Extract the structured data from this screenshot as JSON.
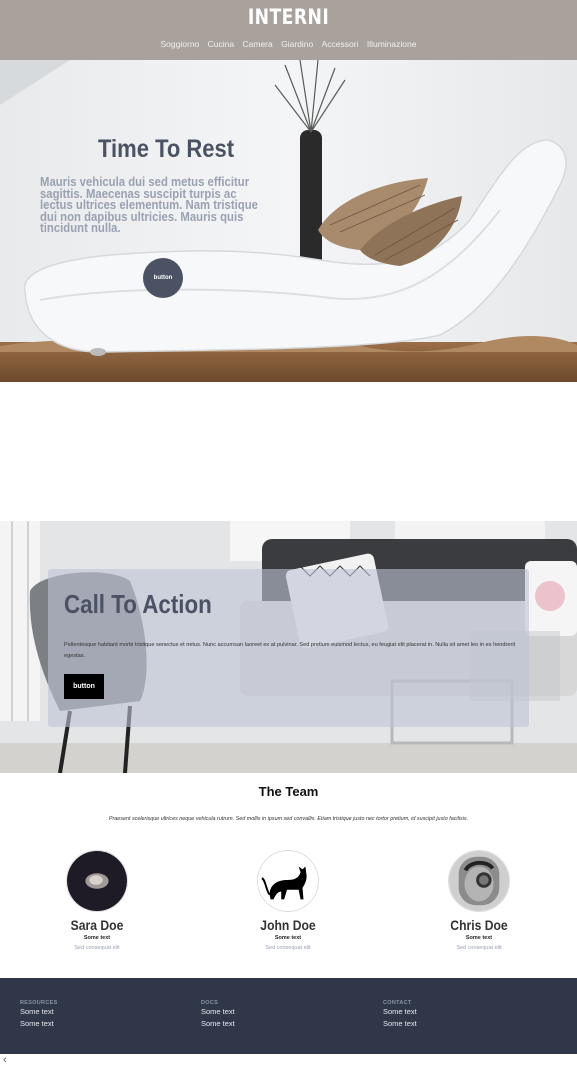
{
  "header": {
    "brand": "INTERNI",
    "nav": [
      "Soggiorno",
      "Cucina",
      "Camera",
      "Giardino",
      "Accessori",
      "Illuminazione"
    ]
  },
  "hero": {
    "title": "Time To Rest",
    "text": "Mauris vehicula dui sed metus efficitur sagittis. Maecenas suscipit turpis ac lectus ultrices elementum. Nam tristique dui non dapibus ultricies. Mauris quis tincidunt nulla.",
    "button": "button"
  },
  "cta": {
    "title": "Call To Action",
    "text": "Pellentesque habitant morbi tristique senectus et netus. Nunc accumsan laoreet ex at pulvinar. Sed pretium euismod lectus, eu feugiat elit placerat in. Nulla sit amet leo in ex hendrerit egestas.",
    "button": "button"
  },
  "team": {
    "title": "The Team",
    "subtitle": "Praesent scelerisque ultrices neque vehicula rutrum. Sed mollis in ipsum sed convallis. Etiam tristique justo nec tortor pretium, id suscipit justo facilisis.",
    "members": [
      {
        "name": "Sara Doe",
        "role": "Some text",
        "desc": "Sed consequat elit"
      },
      {
        "name": "John Doe",
        "role": "Some text",
        "desc": "Sed consequat elit"
      },
      {
        "name": "Chris Doe",
        "role": "Some text",
        "desc": "Sed consequat elit"
      }
    ]
  },
  "footer": {
    "columns": [
      {
        "heading": "RESOURCES",
        "links": [
          "Some text",
          "Some text"
        ]
      },
      {
        "heading": "DOCS",
        "links": [
          "Some text",
          "Some text"
        ]
      },
      {
        "heading": "CONTACT",
        "links": [
          "Some text",
          "Some text"
        ]
      }
    ]
  },
  "colors": {
    "header_bg": "#a8a19c",
    "accent": "#4a5263",
    "footer_bg": "#2f3749"
  }
}
